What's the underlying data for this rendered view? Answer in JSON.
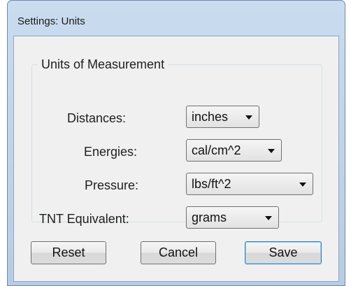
{
  "window": {
    "title": "Settings: Units"
  },
  "group": {
    "legend": "Units of Measurement"
  },
  "rows": [
    {
      "label": "Distances:",
      "value": "inches"
    },
    {
      "label": "Energies:",
      "value": "cal/cm^2"
    },
    {
      "label": "Pressure:",
      "value": "lbs/ft^2"
    },
    {
      "label": "TNT Equivalent:",
      "value": "grams"
    }
  ],
  "buttons": {
    "reset": "Reset",
    "cancel": "Cancel",
    "save": "Save"
  },
  "colors": {
    "titlebar": "#c3d8ee",
    "client": "#f0f0f0",
    "default_button_border": "#3c7fb1"
  }
}
